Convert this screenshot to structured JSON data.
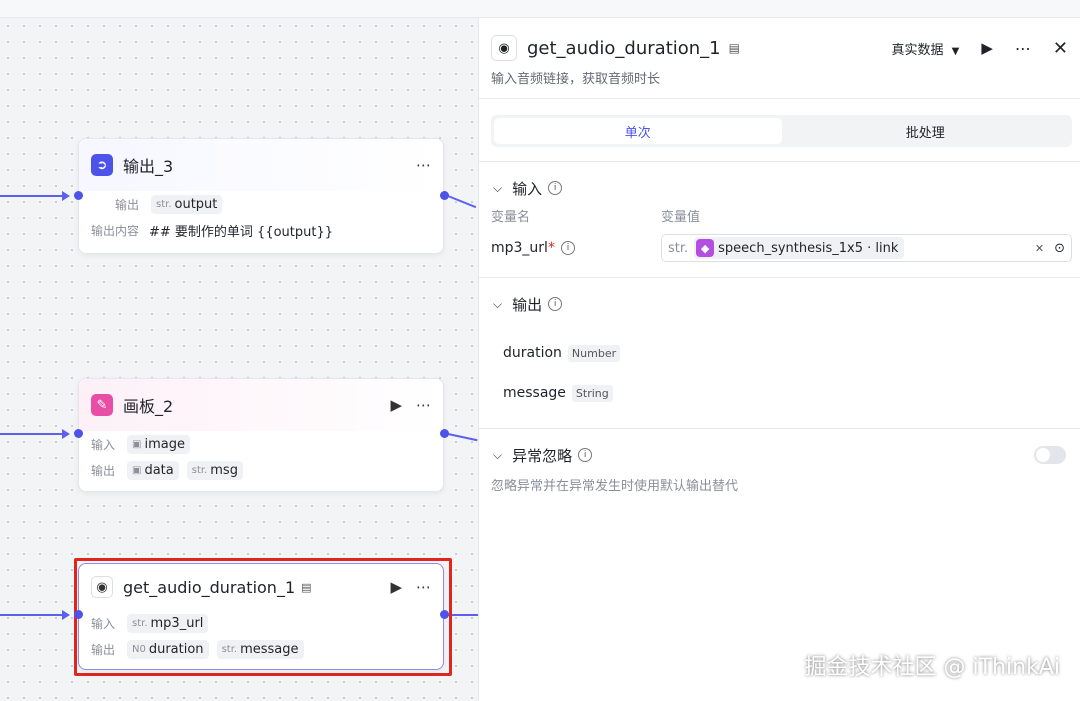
{
  "nodes": {
    "output3": {
      "title": "输出_3",
      "row1_label": "输出",
      "row1_type": "str.",
      "row1_value": "output",
      "row2_label": "输出内容",
      "row2_value": "## 要制作的单词 {{output}}"
    },
    "canvas2": {
      "title": "画板_2",
      "row1_label": "输入",
      "row1_value": "image",
      "row2_label": "输出",
      "row2_value_a": "data",
      "row2_type_b": "str.",
      "row2_value_b": "msg"
    },
    "audio": {
      "title": "get_audio_duration_1",
      "row1_label": "输入",
      "row1_type": "str.",
      "row1_value": "mp3_url",
      "row2_label": "输出",
      "row2_type_a": "N0",
      "row2_value_a": "duration",
      "row2_type_b": "str.",
      "row2_value_b": "message"
    }
  },
  "panel": {
    "title": "get_audio_duration_1",
    "data_mode": "真实数据",
    "subtitle": "输入音频链接，获取音频时长",
    "tabs": [
      "单次",
      "批处理"
    ],
    "input_section": "输入",
    "col_name": "变量名",
    "col_value": "变量值",
    "var_name": "mp3_url",
    "var_required": "*",
    "var_type": "str.",
    "var_ref": "speech_synthesis_1x5 · link",
    "output_section": "输出",
    "outputs": [
      {
        "name": "duration",
        "type": "Number"
      },
      {
        "name": "message",
        "type": "String"
      }
    ],
    "exception_section": "异常忽略",
    "exception_desc": "忽略异常并在异常发生时使用默认输出替代"
  },
  "watermark": "掘金技术社区 @ iThinkAi",
  "colors": {
    "accent": "#4d53e8",
    "highlight": "#e0261e"
  }
}
